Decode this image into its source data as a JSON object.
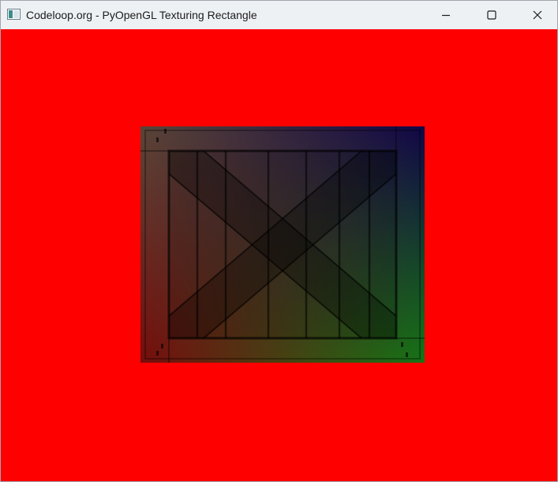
{
  "window": {
    "title": "Codeloop.org - PyOpenGL Texturing Rectangle",
    "app_icon": "python-window-icon",
    "controls": {
      "minimize_icon": "minimize-icon",
      "maximize_icon": "maximize-icon",
      "close_icon": "close-icon"
    }
  },
  "scene": {
    "clear_color": "#ff0000",
    "rectangle": {
      "texture": "wooden-crate",
      "vertex_colors": {
        "top_left": "#8a6a56",
        "top_right": "#1a0a6e",
        "bottom_left": "#b81414",
        "bottom_right": "#22b422"
      }
    }
  }
}
